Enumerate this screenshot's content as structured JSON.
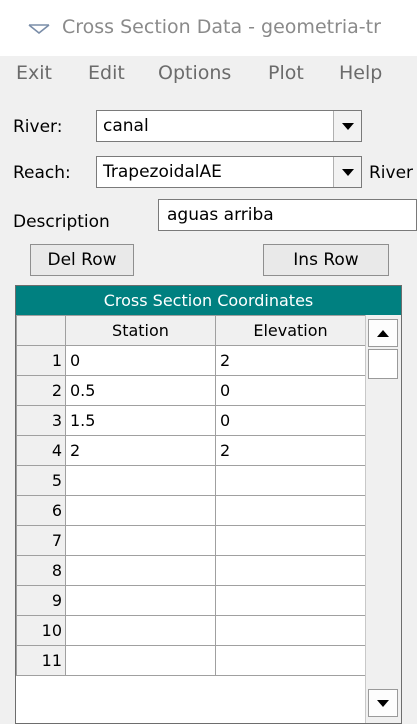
{
  "window": {
    "title": "Cross Section Data - geometria-tr"
  },
  "menu": [
    "Exit",
    "Edit",
    "Options",
    "Plot",
    "Help"
  ],
  "river": {
    "label": "River:",
    "value": "canal"
  },
  "reach": {
    "label": "Reach:",
    "value": "TrapezoidalAE",
    "extra_label": "River"
  },
  "description": {
    "label": "Description",
    "value": "aguas arriba"
  },
  "buttons": {
    "del_row": "Del Row",
    "ins_row": "Ins Row"
  },
  "grid": {
    "title": "Cross Section Coordinates",
    "headers": [
      "Station",
      "Elevation"
    ],
    "row_numbers": [
      "1",
      "2",
      "3",
      "4",
      "5",
      "6",
      "7",
      "8",
      "9",
      "10",
      "11"
    ],
    "rows": [
      [
        "0",
        "2"
      ],
      [
        "0.5",
        "0"
      ],
      [
        "1.5",
        "0"
      ],
      [
        "2",
        "2"
      ],
      [
        "",
        ""
      ],
      [
        "",
        ""
      ],
      [
        "",
        ""
      ],
      [
        "",
        ""
      ],
      [
        "",
        ""
      ],
      [
        "",
        ""
      ],
      [
        "",
        ""
      ]
    ]
  },
  "colors": {
    "grid_title_bg": "#008080",
    "menu_text": "#6b6b6b",
    "title_text": "#8a8a8a"
  }
}
